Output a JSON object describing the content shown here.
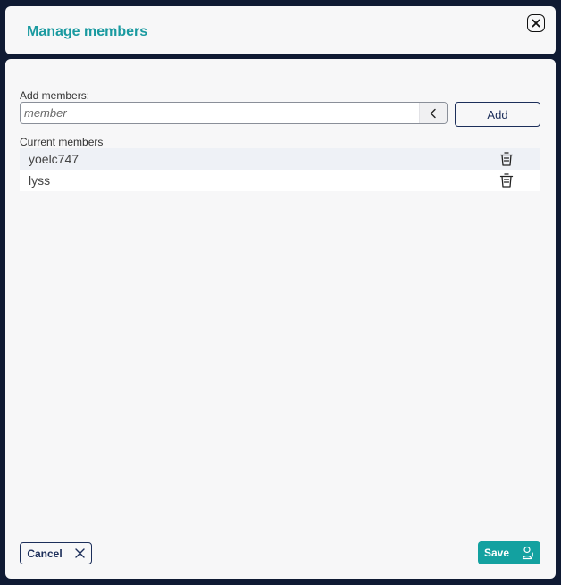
{
  "dialog": {
    "title": "Manage members",
    "close_icon": "close-icon"
  },
  "add_section": {
    "label": "Add members:",
    "input_value": "",
    "input_placeholder": "member",
    "collapse_icon": "chevron-left-icon",
    "add_button_label": "Add"
  },
  "current_members": {
    "label": "Current members",
    "items": [
      {
        "name": "yoelc747",
        "delete_icon": "trash-icon"
      },
      {
        "name": "lyss",
        "delete_icon": "trash-icon"
      }
    ]
  },
  "footer": {
    "cancel_label": "Cancel",
    "cancel_icon": "x-icon",
    "save_label": "Save",
    "save_icon": "user-icon"
  },
  "colors": {
    "backdrop": "#0f1a33",
    "panel": "#f7f7f8",
    "accent": "#1a9aa0",
    "save_button": "#13a1a0",
    "navy": "#1c2e5a",
    "row_alt": "#eef1f6"
  }
}
